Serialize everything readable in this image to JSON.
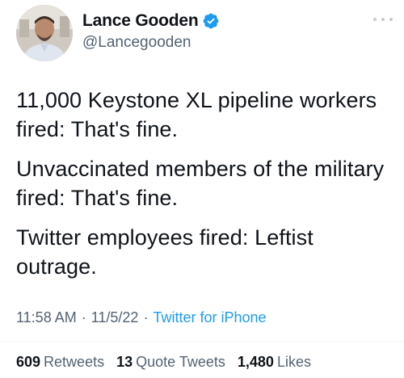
{
  "author": {
    "display_name": "Lance Gooden",
    "handle": "@Lancegooden",
    "verified": true,
    "avatar_icon": "profile-photo"
  },
  "tweet": {
    "paragraphs": [
      "11,000 Keystone XL pipeline workers fired: That's fine.",
      "Unvaccinated members of the military fired: That's fine.",
      "Twitter employees fired: Leftist outrage."
    ]
  },
  "meta": {
    "time": "11:58 AM",
    "separator": "·",
    "date": "11/5/22",
    "source": "Twitter for iPhone"
  },
  "stats": {
    "retweets_count": "609",
    "retweets_label": "Retweets",
    "quotes_count": "13",
    "quotes_label": "Quote Tweets",
    "likes_count": "1,480",
    "likes_label": "Likes"
  },
  "colors": {
    "accent": "#1d9bf0",
    "text": "#0f1419",
    "secondary": "#536471"
  },
  "icons": {
    "verified": "verified-badge-icon",
    "more": "more-options-icon"
  }
}
